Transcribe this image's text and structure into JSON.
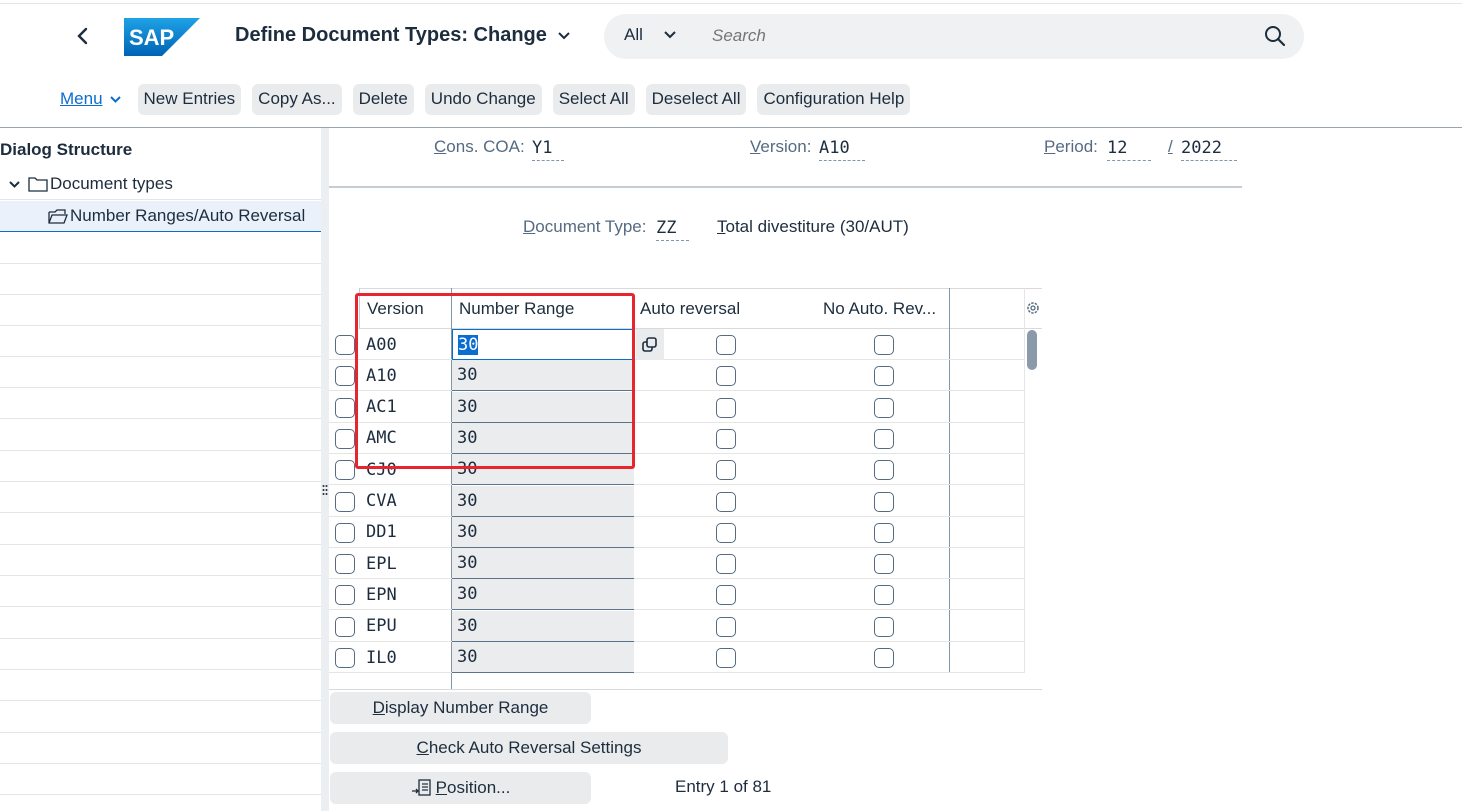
{
  "shell": {
    "logo_text": "SAP",
    "title": "Define Document Types: Change",
    "search_scope": "All",
    "search_placeholder": "Search"
  },
  "toolbar": {
    "menu": "Menu",
    "buttons": [
      "New Entries",
      "Copy As...",
      "Delete",
      "Undo Change",
      "Select All",
      "Deselect All",
      "Configuration Help"
    ]
  },
  "dialog_structure": {
    "title": "Dialog Structure",
    "items": [
      {
        "label": "Document types"
      },
      {
        "label": "Number Ranges/Auto Reversal"
      }
    ]
  },
  "header_fields": {
    "cons_coa_label": "Cons. COA:",
    "cons_coa_value": "Y1",
    "version_label": "Version:",
    "version_value": "A10",
    "period_label": "Period:",
    "period_value": "12",
    "period_sep": "/",
    "year_value": "2022",
    "doc_type_label": "Document Type:",
    "doc_type_value": "ZZ",
    "doc_type_desc": "Total divestiture (30/AUT)"
  },
  "table": {
    "columns": [
      "Version",
      "Number Range",
      "Auto reversal",
      "No Auto. Rev..."
    ],
    "rows": [
      {
        "version": "A00",
        "number_range": "30",
        "auto_reversal": false,
        "no_auto_rev": false
      },
      {
        "version": "A10",
        "number_range": "30",
        "auto_reversal": false,
        "no_auto_rev": false
      },
      {
        "version": "AC1",
        "number_range": "30",
        "auto_reversal": false,
        "no_auto_rev": false
      },
      {
        "version": "AMC",
        "number_range": "30",
        "auto_reversal": false,
        "no_auto_rev": false
      },
      {
        "version": "CJ0",
        "number_range": "30",
        "auto_reversal": false,
        "no_auto_rev": false
      },
      {
        "version": "CVA",
        "number_range": "30",
        "auto_reversal": false,
        "no_auto_rev": false
      },
      {
        "version": "DD1",
        "number_range": "30",
        "auto_reversal": false,
        "no_auto_rev": false
      },
      {
        "version": "EPL",
        "number_range": "30",
        "auto_reversal": false,
        "no_auto_rev": false
      },
      {
        "version": "EPN",
        "number_range": "30",
        "auto_reversal": false,
        "no_auto_rev": false
      },
      {
        "version": "EPU",
        "number_range": "30",
        "auto_reversal": false,
        "no_auto_rev": false
      },
      {
        "version": "IL0",
        "number_range": "30",
        "auto_reversal": false,
        "no_auto_rev": false
      }
    ]
  },
  "bottom": {
    "display_number_range": "Display Number Range",
    "check_auto_reversal": "Check Auto Reversal Settings",
    "position": "Position...",
    "entry_info": "Entry 1 of 81"
  },
  "colors": {
    "accent": "#0a6ed1",
    "highlight_box": "#e8252e"
  }
}
